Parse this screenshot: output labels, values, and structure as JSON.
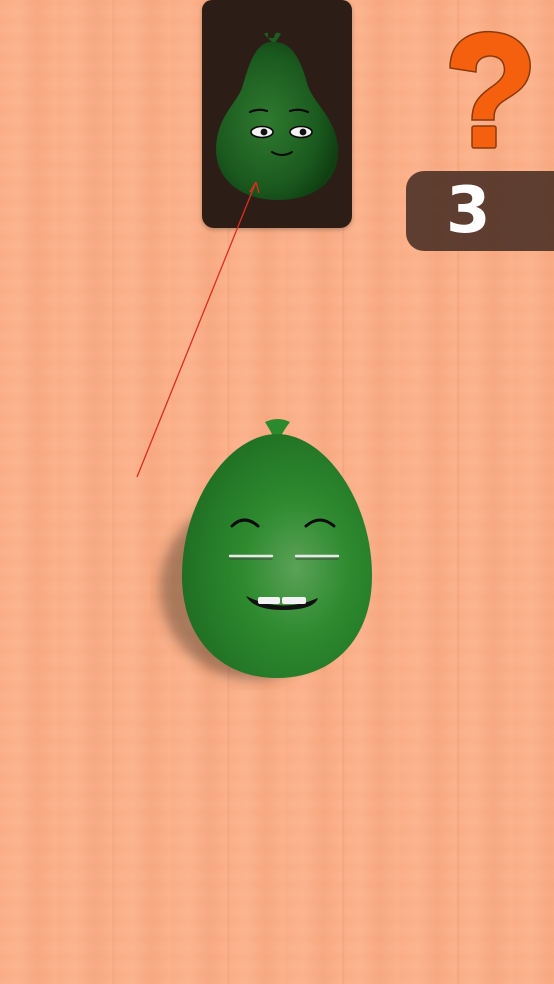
{
  "hud": {
    "hint_glyph": "?",
    "hint_color": "#f5600f",
    "score": "3"
  },
  "target_card": {
    "shape": "pear",
    "face": "neutral-smile",
    "color": "#1f5e22"
  },
  "player_balloon": {
    "shape": "egg",
    "face": "grin-closed-eyes",
    "color": "#2b8a2e"
  },
  "background": {
    "texture": "wood",
    "color": "#fcae85"
  },
  "guide_line_color": "#e02b20"
}
